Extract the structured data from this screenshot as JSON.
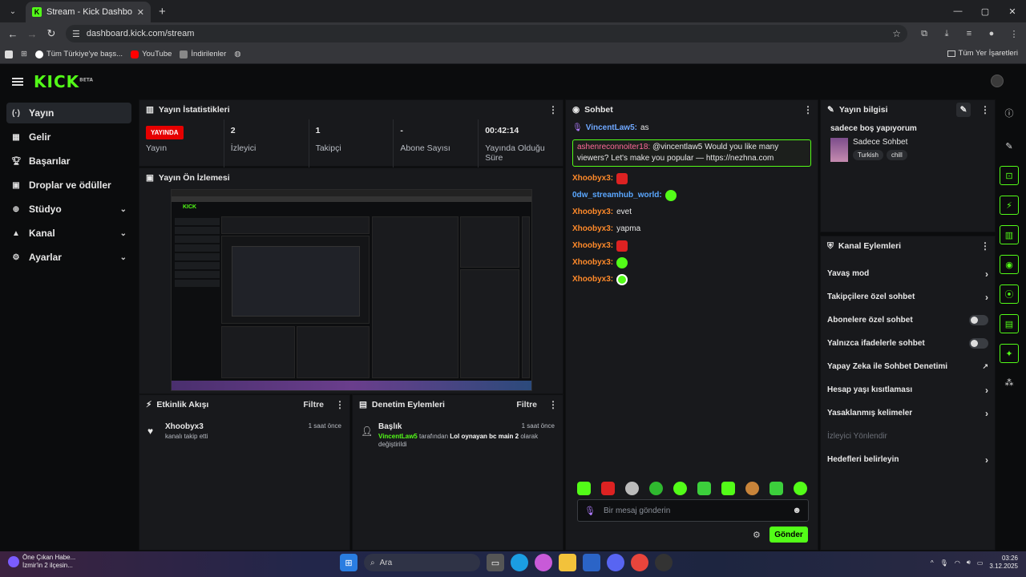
{
  "browser": {
    "tab_title": "Stream - Kick Dashboard",
    "url": "dashboard.kick.com/stream",
    "bookmarks": [
      "Tüm Türkiye'ye başs...",
      "YouTube",
      "İndirilenler"
    ],
    "bookmarks_right": "Tüm Yer İşaretleri"
  },
  "header": {
    "logo": "KICK",
    "logo_badge": "BETA"
  },
  "sidebar": {
    "items": [
      {
        "label": "Yayın",
        "icon": "broadcast-icon"
      },
      {
        "label": "Gelir",
        "icon": "revenue-icon"
      },
      {
        "label": "Başarılar",
        "icon": "trophy-icon"
      },
      {
        "label": "Droplar ve ödüller",
        "icon": "gift-icon"
      },
      {
        "label": "Stüdyo",
        "icon": "studio-icon"
      },
      {
        "label": "Kanal",
        "icon": "channel-icon"
      },
      {
        "label": "Ayarlar",
        "icon": "settings-icon"
      }
    ]
  },
  "stats": {
    "title": "Yayın İstatistikleri",
    "live_badge": "YAYINDA",
    "live_label": "Yayın",
    "viewers_value": "2",
    "viewers_label": "İzleyici",
    "followers_value": "1",
    "followers_label": "Takipçi",
    "subs_value": "-",
    "subs_label": "Abone Sayısı",
    "uptime_value": "00:42:14",
    "uptime_label": "Yayında Olduğu Süre"
  },
  "preview": {
    "title": "Yayın Ön İzlemesi"
  },
  "activity": {
    "title": "Etkinlik Akışı",
    "filter": "Filtre",
    "item_user": "Xhoobyx3",
    "item_text": "kanalı takip etti",
    "item_time": "1 saat önce"
  },
  "moderation": {
    "title": "Denetim Eylemleri",
    "filter": "Filtre",
    "item_title": "Başlık",
    "item_time": "1 saat önce",
    "item_user": "VincentLaw5",
    "item_text_1": "tarafından",
    "item_value": "Lol oynayan bc main 2",
    "item_text_2": "olarak değiştirildi"
  },
  "chat": {
    "title": "Sohbet",
    "messages": [
      {
        "user": "VincentLaw5:",
        "text": "as",
        "color": "#6fa8ff"
      },
      {
        "user": "Xhoobyx3:",
        "text": "",
        "color": "#ff8a2a"
      },
      {
        "user": "0dw_streamhub_world:",
        "text": "",
        "color": "#5aa7ff"
      },
      {
        "user": "Xhoobyx3:",
        "text": "evet",
        "color": "#ff8a2a"
      },
      {
        "user": "Xhoobyx3:",
        "text": "yapma",
        "color": "#ff8a2a"
      },
      {
        "user": "Xhoobyx3:",
        "text": "",
        "color": "#ff8a2a"
      },
      {
        "user": "Xhoobyx3:",
        "text": "",
        "color": "#ff8a2a"
      },
      {
        "user": "Xhoobyx3:",
        "text": "",
        "color": "#ff8a2a"
      }
    ],
    "highlight_user": "ashenreconnoiter18:",
    "highlight_text": "@vincentlaw5 Would you like many viewers? Let's make you popular — https://nezhna.com",
    "input_placeholder": "Bir mesaj gönderin",
    "send_label": "Gönder"
  },
  "stream_info": {
    "title": "Yayın bilgisi",
    "stream_title": "sadece boş yapıyorum",
    "category": "Sadece Sohbet",
    "tags": [
      "Turkish",
      "chill"
    ]
  },
  "channel_actions": {
    "title": "Kanal Eylemleri",
    "items": [
      {
        "label": "Yavaş mod",
        "control": "chevron"
      },
      {
        "label": "Takipçilere özel sohbet",
        "control": "chevron"
      },
      {
        "label": "Abonelere özel sohbet",
        "control": "toggle"
      },
      {
        "label": "Yalnızca ifadelerle sohbet",
        "control": "toggle"
      },
      {
        "label": "Yapay Zeka ile Sohbet Denetimi",
        "control": "external"
      },
      {
        "label": "Hesap yaşı kısıtlaması",
        "control": "chevron"
      },
      {
        "label": "Yasaklanmış kelimeler",
        "control": "chevron"
      },
      {
        "label": "İzleyici Yönlendir",
        "control": "none"
      },
      {
        "label": "Hedefleri belirleyin",
        "control": "chevron"
      }
    ]
  },
  "taskbar": {
    "weather_1": "Öne Çıkan Habe...",
    "weather_2": "İzmir'in 2 ilçesin...",
    "search": "Ara",
    "time": "03:26",
    "date": "3.12.2025"
  },
  "colors": {
    "accent": "#53fc18",
    "live": "#e60000",
    "panel": "#18191c"
  }
}
